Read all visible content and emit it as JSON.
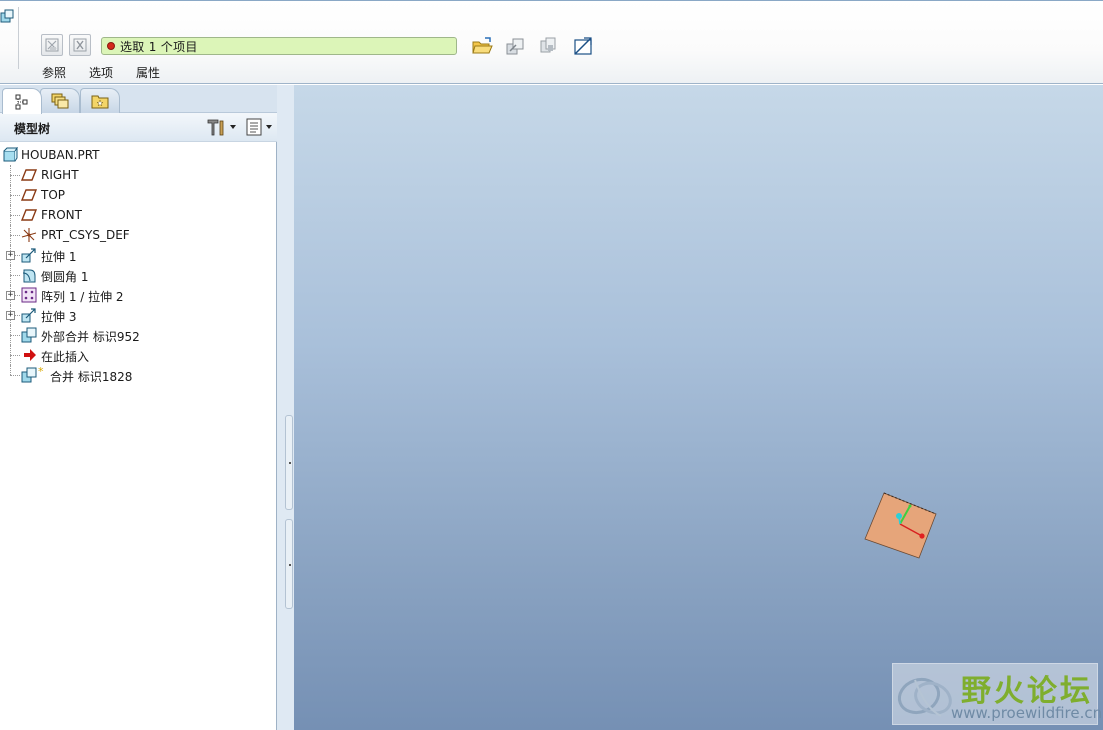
{
  "dashboard": {
    "collector_text": "选取 1 个项目",
    "tabs": [
      "参照",
      "选项",
      "属性"
    ]
  },
  "navigator": {
    "tree_title": "模型树"
  },
  "model_tree": {
    "items": [
      {
        "label": "HOUBAN.PRT",
        "icon": "part-icon"
      },
      {
        "label": "RIGHT",
        "icon": "datum-plane-icon"
      },
      {
        "label": "TOP",
        "icon": "datum-plane-icon"
      },
      {
        "label": "FRONT",
        "icon": "datum-plane-icon"
      },
      {
        "label": "PRT_CSYS_DEF",
        "icon": "coordinate-system-icon"
      },
      {
        "label": "拉伸 1",
        "icon": "extrude-icon"
      },
      {
        "label": "倒圆角 1",
        "icon": "round-icon"
      },
      {
        "label": "阵列 1 / 拉伸 2",
        "icon": "pattern-icon"
      },
      {
        "label": "拉伸 3",
        "icon": "extrude-icon"
      },
      {
        "label": "外部合并 标识952",
        "icon": "merge-icon"
      },
      {
        "label": "在此插入",
        "icon": "insert-here-arrow-icon"
      },
      {
        "label": "合并 标识1828",
        "icon": "merge-new-icon"
      }
    ]
  },
  "watermark": {
    "title": "野火论坛",
    "url": "www.proewildfire.cn"
  },
  "colors": {
    "collector_bg": "#dcf5b8",
    "graphics_top": "#c6d8e8",
    "graphics_bottom": "#7590b4",
    "part_fill": "#e6a57a",
    "insert_arrow": "#d01010"
  }
}
